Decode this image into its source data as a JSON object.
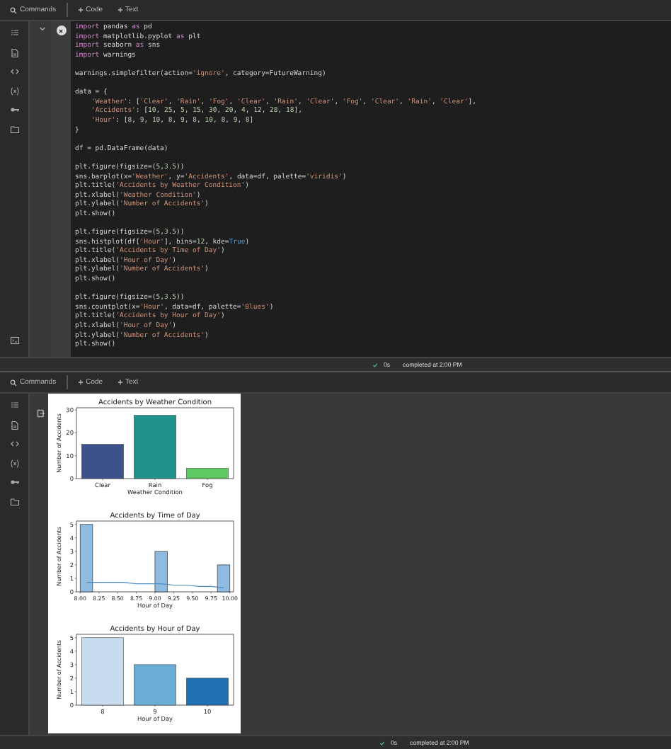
{
  "top_panel": {
    "toolbar": {
      "search_label": "Commands",
      "buttons": [
        "Code",
        "Text"
      ]
    },
    "code_cell": {
      "blocks": [
        [
          "import pandas as pd",
          "import matplotlib.pyplot as plt",
          "import seaborn as sns",
          "import warnings"
        ],
        [
          "warnings.simplefilter(action='ignore', category=FutureWarning)"
        ],
        [
          "data = {",
          "    'Weather': ['Clear', 'Rain', 'Fog', 'Clear', 'Rain', 'Clear', 'Fog', 'Clear', 'Rain', 'Clear'],",
          "    'Accidents': [10, 25, 5, 15, 30, 20, 4, 12, 28, 18],",
          "    'Hour': [8, 9, 10, 8, 9, 8, 10, 8, 9, 8]",
          "}"
        ],
        [
          "df = pd.DataFrame(data)"
        ],
        [
          "plt.figure(figsize=(5,3.5))",
          "sns.barplot(x='Weather', y='Accidents', data=df, palette='viridis')",
          "plt.title('Accidents by Weather Condition')",
          "plt.xlabel('Weather Condition')",
          "plt.ylabel('Number of Accidents')",
          "plt.show()"
        ],
        [
          "plt.figure(figsize=(5,3.5))",
          "sns.histplot(df['Hour'], bins=12, kde=True)",
          "plt.title('Accidents by Time of Day')",
          "plt.xlabel('Hour of Day')",
          "plt.ylabel('Number of Accidents')",
          "plt.show()"
        ],
        [
          "plt.figure(figsize=(5,3.5))",
          "sns.countplot(x='Hour', data=df, palette='Blues')",
          "plt.title('Accidents by Hour of Day')",
          "plt.xlabel('Hour of Day')",
          "plt.ylabel('Number of Accidents')",
          "plt.show()"
        ]
      ]
    },
    "status": {
      "duration": "0s",
      "message": "completed at 2:00 PM"
    }
  },
  "bottom_panel": {
    "toolbar": {
      "search_label": "Commands",
      "buttons": [
        "Code",
        "Text"
      ]
    },
    "outputs": [
      {
        "chart_data": {
          "type": "bar",
          "title": "Accidents by Weather Condition",
          "xlabel": "Weather Condition",
          "ylabel": "Number of Accidents",
          "categories": [
            "Clear",
            "Rain",
            "Fog"
          ],
          "series": [
            {
              "colors": [
                "#3b528b",
                "#21918c",
                "#5ec962"
              ],
              "values": [
                15,
                27.7,
                4.5
              ]
            }
          ],
          "ylim": [
            0,
            31
          ],
          "yticks": [
            0,
            10,
            20,
            30
          ]
        }
      },
      {
        "chart_data": {
          "type": "bar",
          "title": "Accidents by Time of Day",
          "xlabel": "Hour of Day",
          "ylabel": "Number of Accidents",
          "x": [
            8.083,
            8.25,
            8.417,
            8.583,
            8.75,
            8.917,
            9.083,
            9.25,
            9.417,
            9.583,
            9.75,
            9.917
          ],
          "series": [
            {
              "type": "bar",
              "color": "#8fbbe0",
              "values": [
                5,
                0,
                0,
                0,
                0,
                0,
                3,
                0,
                0,
                0,
                0,
                2
              ]
            },
            {
              "type": "line",
              "color": "#4a8cc4",
              "values": [
                0.7,
                0.7,
                0.7,
                0.7,
                0.6,
                0.6,
                0.6,
                0.5,
                0.5,
                0.4,
                0.4,
                0.3
              ]
            }
          ],
          "xlim": [
            7.95,
            10.05
          ],
          "ylim": [
            0,
            5.25
          ],
          "xticks": [
            {
              "value": 8,
              "label": "8.00"
            },
            {
              "value": 8.25,
              "label": "8.25"
            },
            {
              "value": 8.5,
              "label": "8.50"
            },
            {
              "value": 8.75,
              "label": "8.75"
            },
            {
              "value": 9,
              "label": "9.00"
            },
            {
              "value": 9.25,
              "label": "9.25"
            },
            {
              "value": 9.5,
              "label": "9.50"
            },
            {
              "value": 9.75,
              "label": "9.75"
            },
            {
              "value": 10,
              "label": "10.00"
            }
          ],
          "yticks": [
            0,
            1,
            2,
            3,
            4,
            5
          ]
        }
      },
      {
        "chart_data": {
          "type": "bar",
          "title": "Accidents by Hour of Day",
          "xlabel": "Hour of Day",
          "ylabel": "Number of Accidents",
          "categories": [
            "8",
            "9",
            "10"
          ],
          "series": [
            {
              "colors": [
                "#c8dcf0",
                "#6aaed6",
                "#2070b4"
              ],
              "values": [
                5,
                3,
                2
              ]
            }
          ],
          "ylim": [
            0,
            5.25
          ],
          "yticks": [
            0,
            1,
            2,
            3,
            4,
            5
          ]
        }
      }
    ],
    "status": {
      "duration": "0s",
      "message": "completed at 2:00 PM"
    }
  }
}
